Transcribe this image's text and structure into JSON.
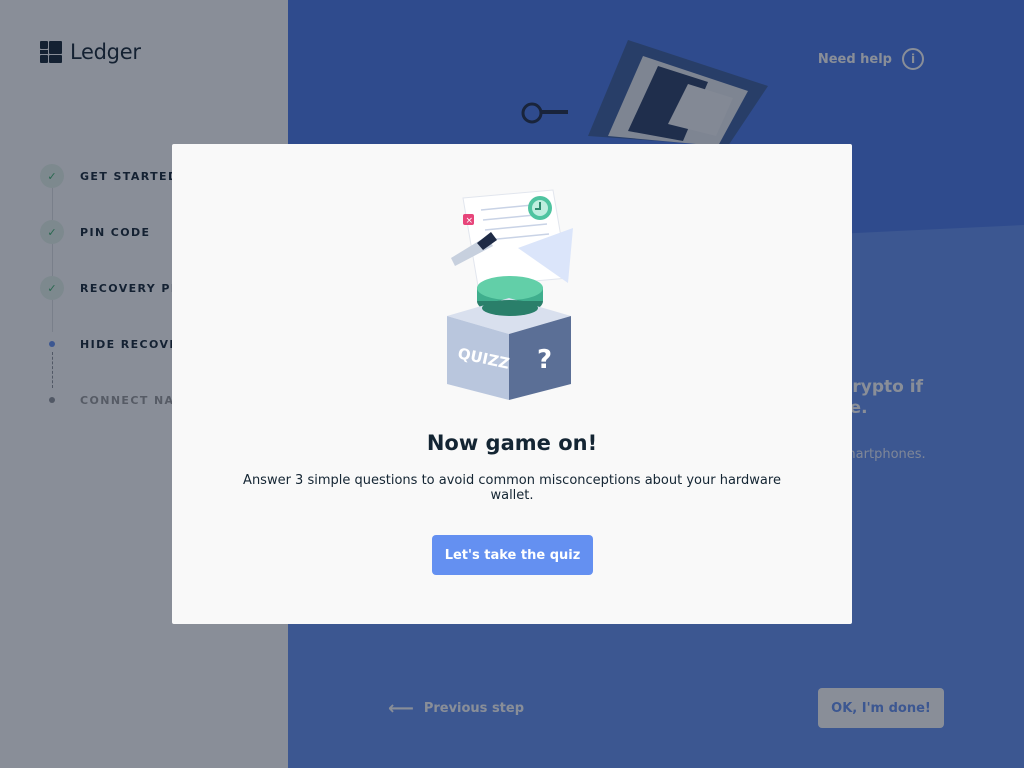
{
  "app": {
    "logo_text": "Ledger"
  },
  "sidebar": {
    "steps": [
      {
        "label": "GET STARTED",
        "status": "done"
      },
      {
        "label": "PIN CODE",
        "status": "done"
      },
      {
        "label": "RECOVERY PHRASE",
        "status": "done"
      },
      {
        "label": "HIDE RECOVERY PHRASE",
        "status": "active"
      },
      {
        "label": "CONNECT NANO",
        "status": "pending"
      }
    ]
  },
  "main": {
    "help_label": "Need help",
    "heading_partial": "r crypto if\nace.",
    "subtext_partial": "martphones.",
    "previous_step": "Previous step",
    "ok_button": "OK, I'm done!"
  },
  "modal": {
    "title": "Now game on!",
    "description": "Answer 3 simple questions to avoid common misconceptions about your hardware wallet.",
    "cta": "Let's take the quiz",
    "illustration_text": "QUIZZ"
  },
  "colors": {
    "accent": "#6490f1",
    "dark_text": "#142533",
    "success": "#41b26e"
  }
}
